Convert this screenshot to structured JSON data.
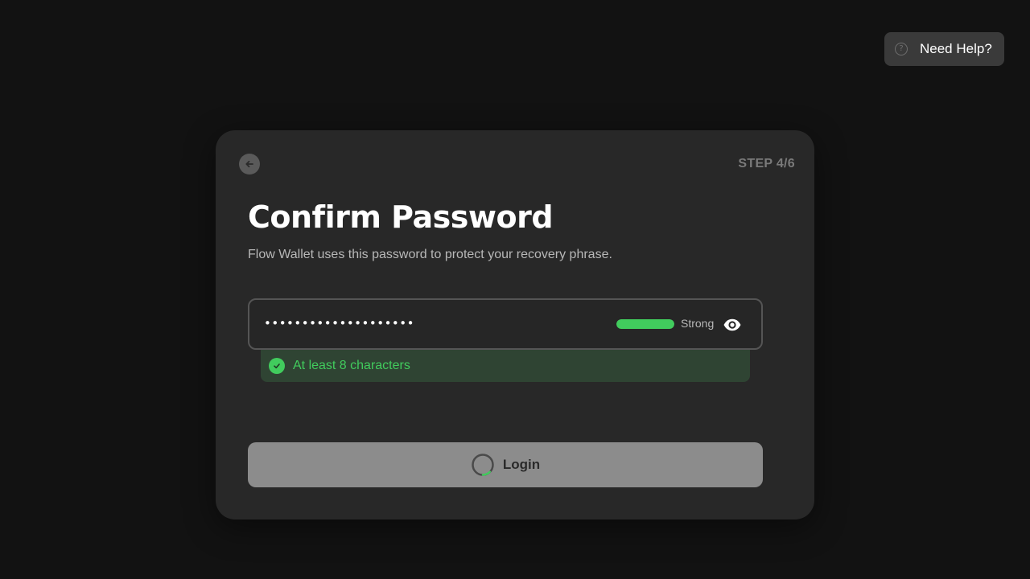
{
  "help": {
    "icon": "question-circle-icon",
    "icon_glyph": "?",
    "label": "Need Help?"
  },
  "card": {
    "back_icon": "arrow-left-icon",
    "step": "STEP 4/6",
    "title": "Confirm Password",
    "subtitle": "Flow Wallet uses this password to protect your recovery phrase."
  },
  "password": {
    "masked_value": "••••••••••••••••••••",
    "strength_label": "Strong",
    "strength_fraction": 1.0,
    "strength_color": "#41cc5d",
    "toggle_icon": "eye-icon"
  },
  "requirements": [
    {
      "label": "At least 8 characters",
      "met": true,
      "icon": "check-circle-icon"
    }
  ],
  "login": {
    "label": "Login",
    "state_icon": "loading-spinner-icon"
  },
  "colors": {
    "background": "#121212",
    "card": "#282828",
    "accent_green": "#41cc5d",
    "button_disabled": "#8c8c8c"
  }
}
